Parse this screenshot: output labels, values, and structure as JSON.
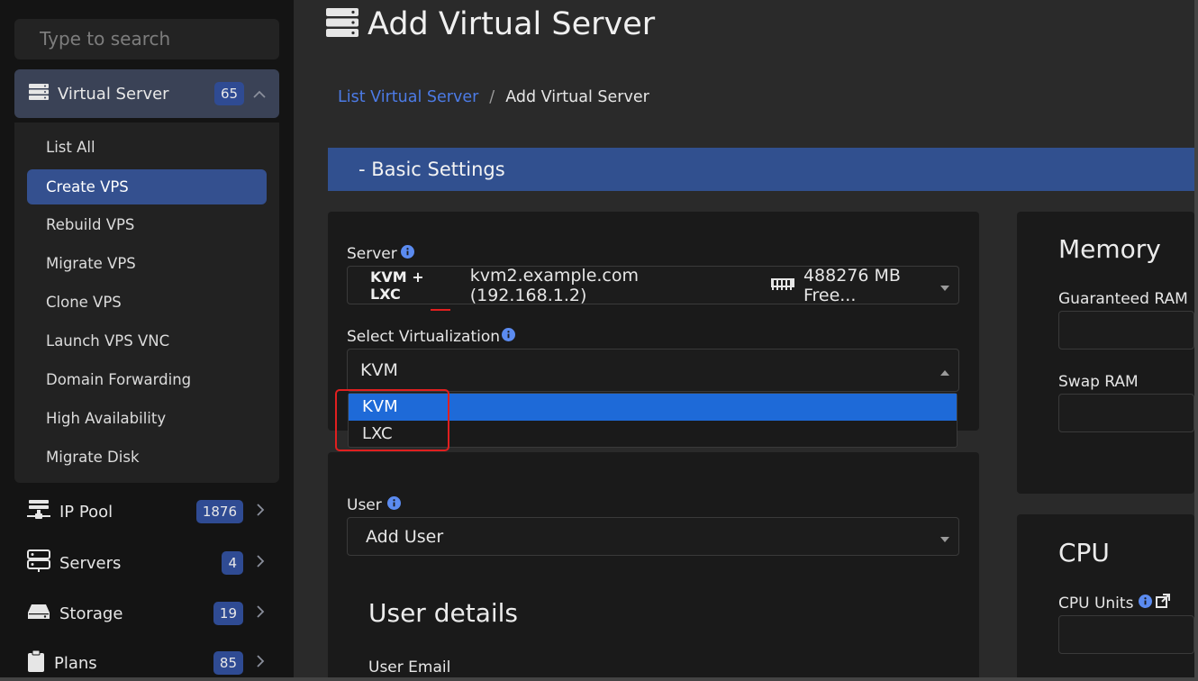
{
  "sidebar": {
    "search_placeholder": "Type to search",
    "virtual_server": {
      "label": "Virtual Server",
      "count": "65"
    },
    "submenu": [
      {
        "label": "List All"
      },
      {
        "label": "Create VPS"
      },
      {
        "label": "Rebuild VPS"
      },
      {
        "label": "Migrate VPS"
      },
      {
        "label": "Clone VPS"
      },
      {
        "label": "Launch VPS VNC"
      },
      {
        "label": "Domain Forwarding"
      },
      {
        "label": "High Availability"
      },
      {
        "label": "Migrate Disk"
      }
    ],
    "nav": [
      {
        "label": "IP Pool",
        "count": "1876"
      },
      {
        "label": "Servers",
        "count": "4"
      },
      {
        "label": "Storage",
        "count": "19"
      },
      {
        "label": "Plans",
        "count": "85"
      }
    ]
  },
  "page": {
    "title": "Add Virtual Server",
    "breadcrumb": {
      "parent": "List Virtual Server",
      "current": "Add Virtual Server"
    },
    "section_title": "-  Basic Settings"
  },
  "form": {
    "server_label": "Server",
    "server_value": {
      "virt": "KVM + LXC",
      "host": "kvm2.example.com (192.168.1.2)",
      "free": "488276 MB Free..."
    },
    "virt_label": "Select Virtualization",
    "virt_value": "KVM",
    "virt_options": [
      "KVM",
      "LXC"
    ],
    "user_label": "User",
    "user_value": "Add User",
    "user_details_title": "User details",
    "user_email_label": "User Email"
  },
  "memory": {
    "title": "Memory",
    "guaranteed_label": "Guaranteed RAM",
    "swap_label": "Swap RAM"
  },
  "cpu": {
    "title": "CPU",
    "units_label": "CPU Units"
  },
  "colors": {
    "accent": "#31508f",
    "selected_option": "#1e6ad8",
    "highlight": "#e01f1f",
    "link": "#4c7be6"
  }
}
